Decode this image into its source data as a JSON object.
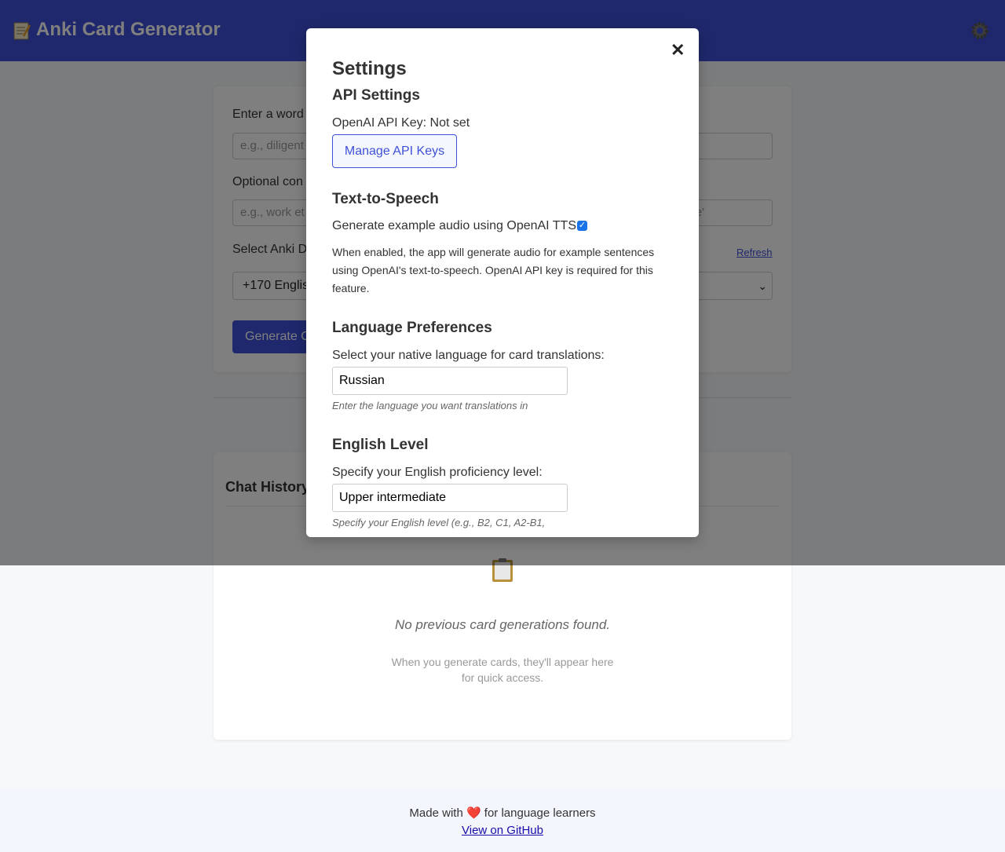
{
  "header": {
    "title": "Anki Card Generator",
    "logo_icon": "memo-icon",
    "settings_icon": "gear-icon"
  },
  "form": {
    "word_label": "Enter a word",
    "word_placeholder": "e.g., diligent",
    "context_label": "Optional con",
    "context_placeholder": "e.g., work et",
    "context_suffix": "e'",
    "deck_label": "Select Anki D",
    "refresh_label": "Refresh",
    "deck_value": "+170 Englis",
    "generate_label": "Generate C"
  },
  "history": {
    "title": "Chat History",
    "empty_icon": "clipboard-icon",
    "empty_title": "No previous card generations found.",
    "empty_sub": "When you generate cards, they'll appear here for quick access."
  },
  "footer": {
    "made_with": "Made with ❤️ for language learners",
    "link": "View on GitHub"
  },
  "modal": {
    "close": "✕",
    "title": "Settings",
    "api_heading": "API Settings",
    "api_status": "OpenAI API Key: Not set",
    "manage_button": "Manage API Keys",
    "tts_heading": "Text-to-Speech",
    "tts_label": "Generate example audio using OpenAI TTS",
    "tts_checked": true,
    "tts_description": "When enabled, the app will generate audio for example sentences using OpenAI's text-to-speech. OpenAI API key is required for this feature.",
    "lang_heading": "Language Preferences",
    "lang_label": "Select your native language for card translations:",
    "lang_value": "Russian",
    "lang_hint": "Enter the language you want translations in",
    "level_heading": "English Level",
    "level_label": "Specify your English proficiency level:",
    "level_value": "Upper intermediate",
    "level_hint": "Specify your English level (e.g., B2, C1, A2-B1,"
  },
  "colors": {
    "accent": "#3f51d8",
    "overlay": "rgba(0,0,0,0.5)"
  }
}
